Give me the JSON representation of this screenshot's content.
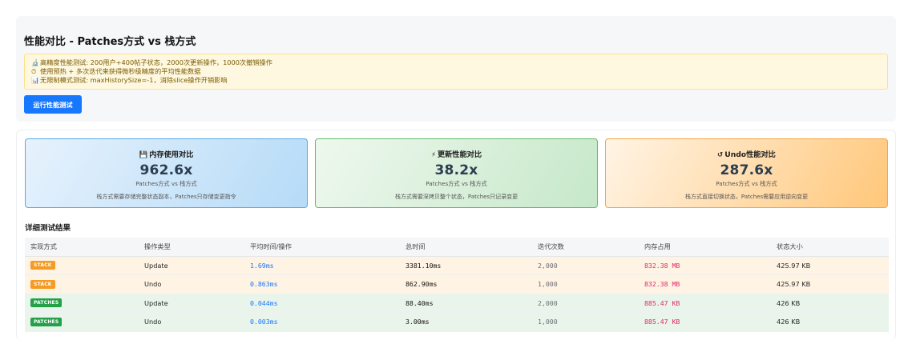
{
  "header": {
    "title": "性能对比 - Patches方式 vs 栈方式",
    "info_lines": [
      {
        "icon": "microscope-icon",
        "glyph": "🔬",
        "text": "高精度性能测试: 200用户+400帖子状态，2000次更新操作，1000次撤销操作"
      },
      {
        "icon": "timer-icon",
        "glyph": "⏱",
        "text": "使用预热 + 多次迭代来获得微秒级精度的平均性能数据"
      },
      {
        "icon": "bar-chart-icon",
        "glyph": "📊",
        "text": "无限制模式测试: maxHistorySize=-1，消除slice操作开销影响"
      }
    ],
    "run_button": "运行性能测试"
  },
  "cards": [
    {
      "icon": "floppy-disk-icon",
      "glyph": "💾",
      "title": "内存使用对比",
      "value": "962.6x",
      "sub": "Patches方式 vs 栈方式",
      "note": "栈方式需要存储完整状态副本，Patches只存储变更指令",
      "accent": "#5aa9e6"
    },
    {
      "icon": "lightning-icon",
      "glyph": "⚡",
      "title": "更新性能对比",
      "value": "38.2x",
      "sub": "Patches方式 vs 栈方式",
      "note": "栈方式需要深拷贝整个状态，Patches只记录变更",
      "accent": "#62bb6a"
    },
    {
      "icon": "undo-icon",
      "glyph": "↺",
      "title": "Undo性能对比",
      "value": "287.6x",
      "sub": "Patches方式 vs 栈方式",
      "note": "栈方式直接切换状态，Patches需要应用逆向变更",
      "accent": "#f5a742"
    }
  ],
  "details": {
    "title": "详细测试结果",
    "columns": [
      "实现方式",
      "操作类型",
      "平均时间/操作",
      "总时间",
      "迭代次数",
      "内存占用",
      "状态大小"
    ],
    "rows": [
      {
        "impl": "STACK",
        "op": "Update",
        "avg": "1.69ms",
        "total": "3381.10ms",
        "iter": "2,000",
        "mem": "832.38 MB",
        "size": "425.97 KB"
      },
      {
        "impl": "STACK",
        "op": "Undo",
        "avg": "0.863ms",
        "total": "862.90ms",
        "iter": "1,000",
        "mem": "832.38 MB",
        "size": "425.97 KB"
      },
      {
        "impl": "PATCHES",
        "op": "Update",
        "avg": "0.044ms",
        "total": "88.40ms",
        "iter": "2,000",
        "mem": "885.47 KB",
        "size": "426 KB"
      },
      {
        "impl": "PATCHES",
        "op": "Undo",
        "avg": "0.003ms",
        "total": "3.00ms",
        "iter": "1,000",
        "mem": "885.47 KB",
        "size": "426 KB"
      }
    ]
  },
  "colors": {
    "primary": "#1677ff",
    "stack_badge": "#f59a23",
    "patches_badge": "#24a148",
    "memory_text": "#e5266b"
  }
}
